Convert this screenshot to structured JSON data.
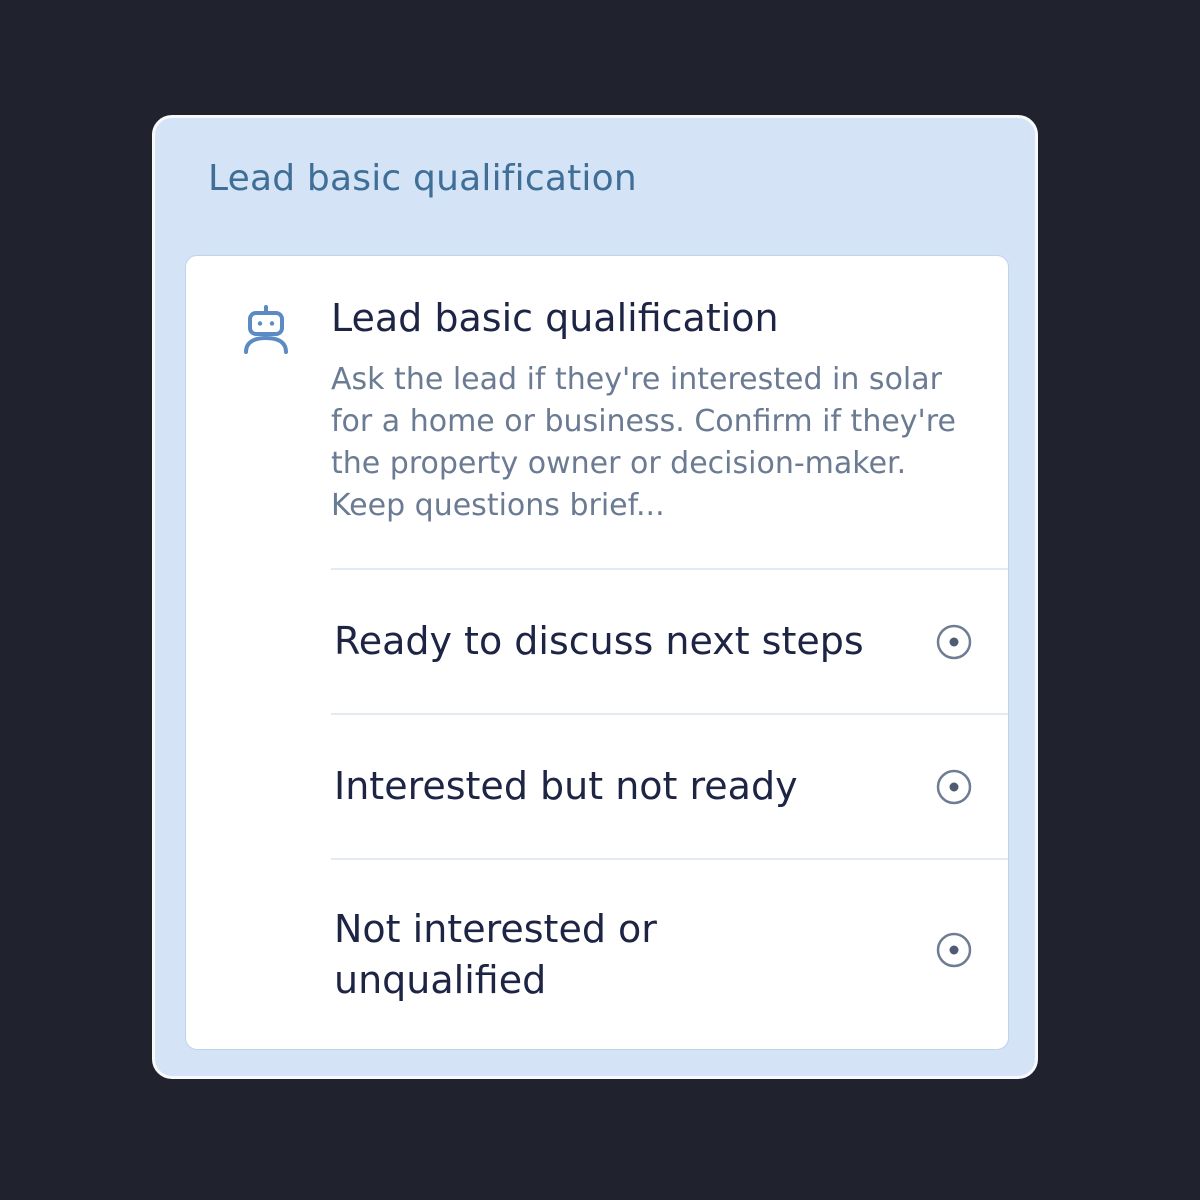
{
  "panel": {
    "header_title": "Lead basic qualification"
  },
  "node": {
    "icon": "robot-icon",
    "title": "Lead basic qualification",
    "description": "Ask the lead if they're interested in solar for a home or business. Confirm if they're the property owner or decision-maker. Keep questions brief..."
  },
  "options": [
    {
      "label": "Ready to discuss next steps",
      "icon": "radio-target-icon"
    },
    {
      "label": "Interested but not ready",
      "icon": "radio-target-icon"
    },
    {
      "label": "Not interested or unqualified",
      "icon": "radio-target-icon"
    }
  ],
  "colors": {
    "background": "#20232d",
    "panel": "#d4e3f6",
    "panel_title": "#3f6e97",
    "icon_blue": "#5b8ac4",
    "text_dark": "#1d2444",
    "text_muted": "#6b7b93"
  }
}
